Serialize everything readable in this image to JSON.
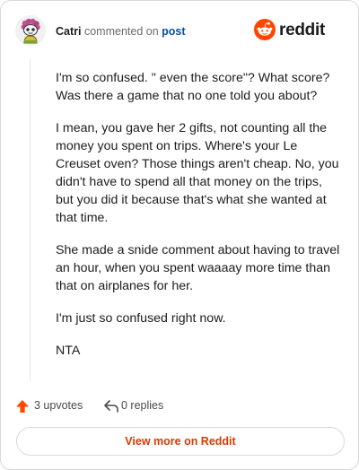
{
  "header": {
    "author": "Catri",
    "action_text": "commented on",
    "post_link": "post",
    "logo_text": "reddit"
  },
  "comment": {
    "paragraphs": [
      "I'm so confused. \" even the score\"? What score? Was there a game that no one told you about?",
      "I mean, you gave her 2 gifts, not counting all the money you spent on trips. Where's your Le Creuset oven? Those things aren't cheap. No, you didn't have to spend all that money on the trips, but you did it because that's what she wanted at that time.",
      "She made a snide comment about having to travel an hour, when you spent waaaay more time than that on airplanes for her.",
      "I'm just so confused right now.",
      "NTA"
    ]
  },
  "footer": {
    "upvotes": "3 upvotes",
    "replies": "0 replies",
    "view_more": "View more on Reddit"
  },
  "colors": {
    "brand": "#ff4500",
    "link": "#0a4fa8",
    "button_text": "#d93a00"
  },
  "icons": {
    "logo": "reddit-snoo-icon",
    "upvote": "upvote-arrow-icon",
    "reply": "reply-arrow-icon"
  }
}
